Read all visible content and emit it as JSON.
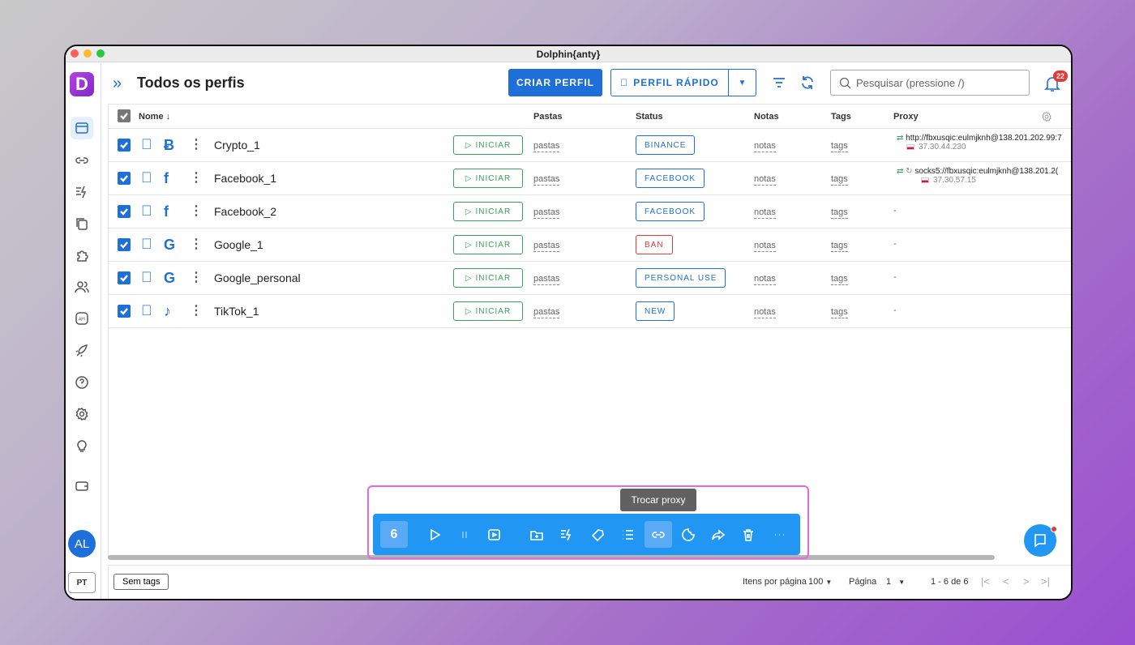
{
  "window": {
    "title": "Dolphin{anty}"
  },
  "header": {
    "title": "Todos os perfis",
    "create_label": "CRIAR PERFIL",
    "quick_label": "PERFIL RÁPIDO",
    "search_placeholder": "Pesquisar (pressione /)",
    "notifications": "22"
  },
  "sidebar": {
    "avatar": "AL",
    "language": "PT"
  },
  "table": {
    "columns": {
      "name": "Nome",
      "folders": "Pastas",
      "status": "Status",
      "notes": "Notas",
      "tags": "Tags",
      "proxy": "Proxy"
    },
    "rows": [
      {
        "name": "Crypto_1",
        "site_icon": "bitcoin-icon",
        "start": "INICIAR",
        "folders": "pastas",
        "status": "BINANCE",
        "notes": "notas",
        "tags": "tags",
        "proxy": "http://fbxusqic:eulmjknh@138.201.202.99:7",
        "proxy_ip": "37.30.44.230"
      },
      {
        "name": "Facebook_1",
        "site_icon": "facebook-icon",
        "start": "INICIAR",
        "folders": "pastas",
        "status": "FACEBOOK",
        "notes": "notas",
        "tags": "tags",
        "proxy": "socks5://fbxusqic:eulmjknh@138.201.2(",
        "proxy_ip": "37.30.57.15"
      },
      {
        "name": "Facebook_2",
        "site_icon": "facebook-icon",
        "start": "INICIAR",
        "folders": "pastas",
        "status": "FACEBOOK",
        "notes": "notas",
        "tags": "tags",
        "proxy": "-"
      },
      {
        "name": "Google_1",
        "site_icon": "google-icon",
        "start": "INICIAR",
        "folders": "pastas",
        "status": "BAN",
        "notes": "notas",
        "tags": "tags",
        "proxy": "-"
      },
      {
        "name": "Google_personal",
        "site_icon": "google-icon",
        "start": "INICIAR",
        "folders": "pastas",
        "status": "PERSONAL USE",
        "notes": "notas",
        "tags": "tags",
        "proxy": "-"
      },
      {
        "name": "TikTok_1",
        "site_icon": "tiktok-icon",
        "start": "INICIAR",
        "folders": "pastas",
        "status": "NEW",
        "notes": "notas",
        "tags": "tags",
        "proxy": "-"
      }
    ]
  },
  "actionbar": {
    "selected_count": "6",
    "tooltip": "Trocar proxy"
  },
  "footer": {
    "tags_button": "Sem tags",
    "per_page_label": "Itens por página",
    "per_page_value": "100",
    "page_label": "Página",
    "page_value": "1",
    "range": "1 - 6 de 6"
  },
  "colors": {
    "accent": "#1e6fd9",
    "start_green": "#3aa35a",
    "ban_red": "#e53935",
    "actionbar": "#2196f3"
  }
}
